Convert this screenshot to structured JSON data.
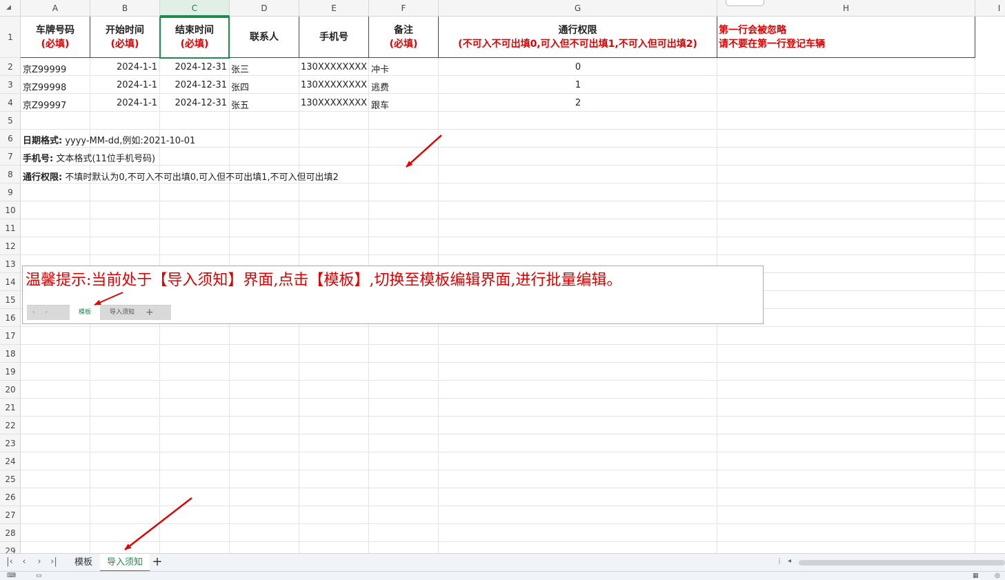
{
  "columns": [
    "A",
    "B",
    "C",
    "D",
    "E",
    "F",
    "G",
    "H",
    "I"
  ],
  "rows": [
    "1",
    "2",
    "3",
    "4",
    "5",
    "6",
    "7",
    "8",
    "9",
    "10",
    "11",
    "12",
    "13",
    "14",
    "15",
    "16",
    "17",
    "18",
    "19",
    "20",
    "21",
    "22",
    "23",
    "24",
    "25",
    "26",
    "27",
    "28",
    "29"
  ],
  "selected_column": "C",
  "header": {
    "plate": [
      "车牌号码",
      "(必填)"
    ],
    "start": [
      "开始时间",
      "(必填)"
    ],
    "end": [
      "结束时间",
      "(必填)"
    ],
    "contact": "联系人",
    "phone": "手机号",
    "remark": [
      "备注",
      "(必填)"
    ],
    "permission": [
      "通行权限",
      "(不可入不可出填0,可入但不可出填1,不可入但可出填2)"
    ],
    "warning": [
      "第一行会被忽略",
      "请不要在第一行登记车辆"
    ]
  },
  "data_rows": [
    {
      "plate": "京Z99999",
      "start": "2024-1-1",
      "end": "2024-12-31",
      "contact": "张三",
      "phone": "130XXXXXXXX",
      "remark": "冲卡",
      "permission": "0"
    },
    {
      "plate": "京Z99998",
      "start": "2024-1-1",
      "end": "2024-12-31",
      "contact": "张四",
      "phone": "130XXXXXXXX",
      "remark": "逃费",
      "permission": "1"
    },
    {
      "plate": "京Z99997",
      "start": "2024-1-1",
      "end": "2024-12-31",
      "contact": "张五",
      "phone": "130XXXXXXXX",
      "remark": "跟车",
      "permission": "2"
    }
  ],
  "notes": {
    "date_label": "日期格式:",
    "date_text": "yyyy-MM-dd,例如:2021-10-01",
    "phone_label": "手机号:",
    "phone_text": "文本格式(11位手机号码)",
    "perm_label": "通行权限:",
    "perm_text": "不填时默认为0,不可入不可出填0,可入但不可出填1,不可入但可出填2"
  },
  "tip": {
    "text": "温馨提示:当前处于【导入须知】界面,点击【模板】,切换至模板编辑界面,进行批量编辑。",
    "mini_tab_template": "模板",
    "mini_tab_notice": "导入须知",
    "mini_add": "+",
    "mini_navs": "‹ ›"
  },
  "sheet_tabs": [
    {
      "label": "模板",
      "active": false
    },
    {
      "label": "导入须知",
      "active": true
    }
  ],
  "add_sheet": "+",
  "nav_icons": {
    "first": "|‹",
    "prev": "‹",
    "next": "›",
    "last": "›|"
  },
  "colors": {
    "accent": "#1f8a4d",
    "warning": "#e00000"
  }
}
